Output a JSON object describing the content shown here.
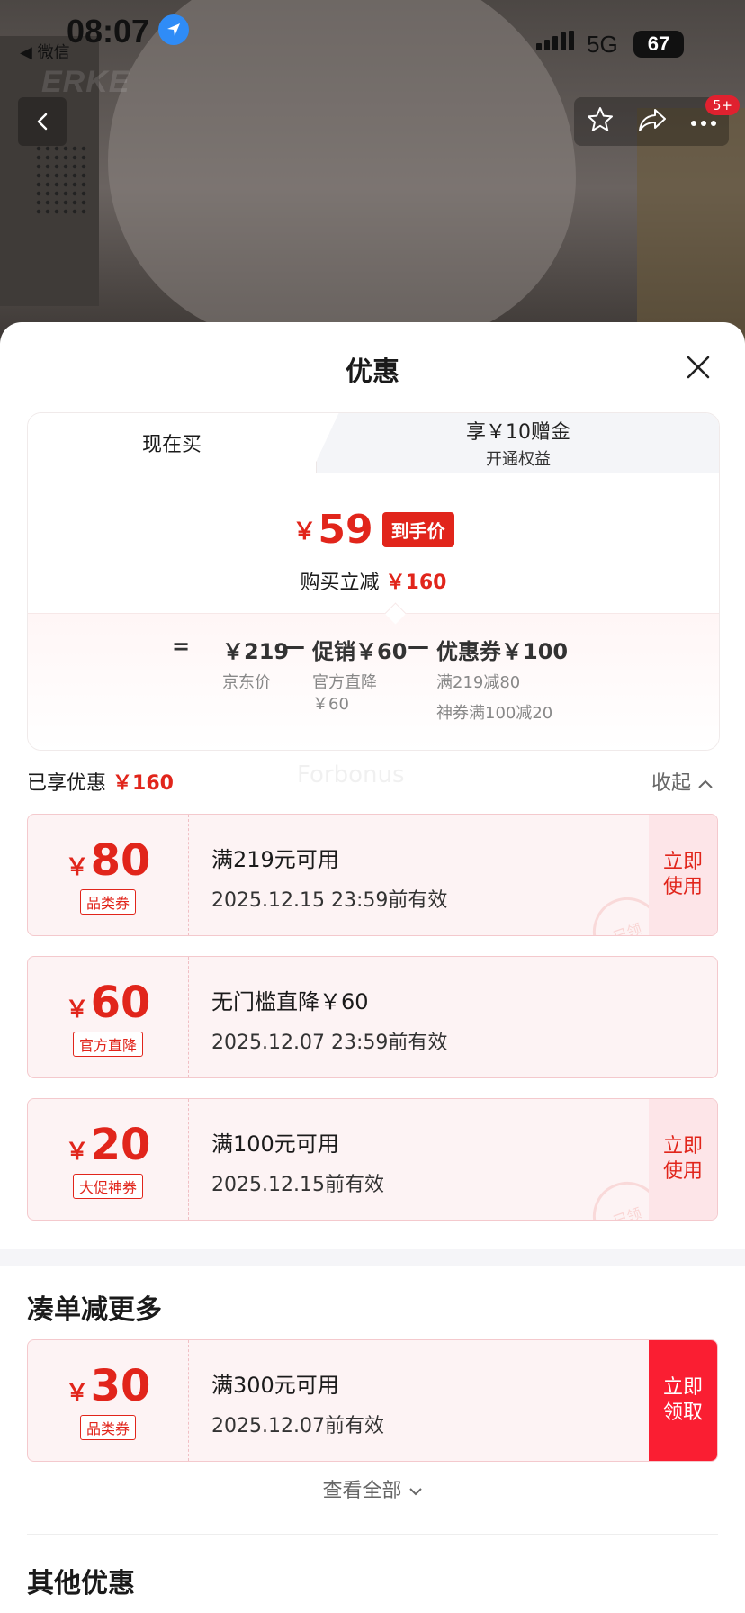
{
  "status_bar": {
    "time": "08:07",
    "back_app": "◀ 微信",
    "network": "5G",
    "battery": "67"
  },
  "hero": {
    "brand_watermark": "ERKE",
    "badge": "5+"
  },
  "sheet": {
    "title": "优惠",
    "tabs": [
      {
        "label": "现在买"
      },
      {
        "label": "享￥10赠金",
        "sub": "开通权益"
      }
    ],
    "final_price": {
      "currency": "￥",
      "amount": "59",
      "tag": "到手价"
    },
    "saving": {
      "label": "购买立减",
      "amount": "￥160"
    },
    "formula": {
      "equals": "=",
      "base": "￥219",
      "minus1": "—",
      "promo": "促销￥60",
      "minus2": "—",
      "coupon": "优惠券￥100"
    },
    "formula_sub": {
      "base_label": "京东价",
      "promo_label_1": "官方直降",
      "promo_label_2": "￥60",
      "coupon_label_1": "满219减80",
      "coupon_label_2": "神券满100减20"
    },
    "enjoyed": {
      "label": "已享优惠",
      "amount": "￥160"
    },
    "collapse": "收起",
    "watermark": "Forbonus"
  },
  "coupons": [
    {
      "currency": "￥",
      "amount": "80",
      "type": "品类券",
      "condition": "满219元可用",
      "expiry": "2025.12.15 23:59前有效",
      "action": [
        "立即",
        "使用"
      ],
      "stamp": "已领"
    },
    {
      "currency": "￥",
      "amount": "60",
      "type": "官方直降",
      "condition": "无门槛直降￥60",
      "expiry": "2025.12.07 23:59前有效"
    },
    {
      "currency": "￥",
      "amount": "20",
      "type": "大促神券",
      "condition": "满100元可用",
      "expiry": "2025.12.15前有效",
      "action": [
        "立即",
        "使用"
      ],
      "stamp": "已领"
    }
  ],
  "more_section": {
    "title": "凑单减更多",
    "coupon": {
      "currency": "￥",
      "amount": "30",
      "type": "品类券",
      "condition": "满300元可用",
      "expiry": "2025.12.07前有效",
      "action": [
        "立即",
        "领取"
      ]
    },
    "view_all": "查看全部"
  },
  "other_section": {
    "title": "其他优惠"
  },
  "colors": {
    "accent": "#e1251b",
    "coupon_bg": "#fdf3f4",
    "solid_action": "#fa1e32"
  }
}
